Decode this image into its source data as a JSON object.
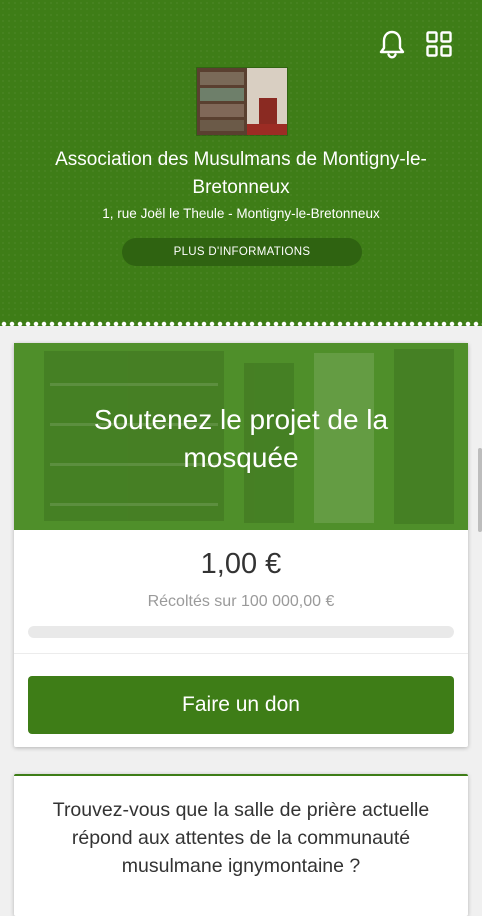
{
  "header": {
    "organization_name": "Association des Musulmans de Montigny-le-Bretonneux",
    "address": "1, rue Joël le Theule - Montigny-le-Bretonneux",
    "more_info_label": "PLUS D'INFORMATIONS",
    "icons": [
      "bell-icon",
      "grid-icon"
    ]
  },
  "project": {
    "title": "Soutenez le projet de la mosquée",
    "amount_raised": "1,00 €",
    "collected_text": "Récoltés sur 100 000,00 €",
    "progress": 1e-05,
    "donate_label": "Faire un don"
  },
  "survey": {
    "question": "Trouvez-vous que la salle de prière actuelle répond aux attentes de la communauté musulmane ignymontaine ?"
  },
  "colors": {
    "primary_green": "#3e7d17",
    "banner_green": "#4f8f2a",
    "background": "#f0f0f0"
  }
}
